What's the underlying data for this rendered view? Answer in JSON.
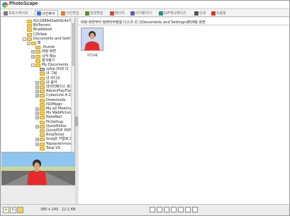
{
  "window": {
    "title": "PhotoScape"
  },
  "tabs": [
    {
      "label": "포토스케이프",
      "icon": "home-icon",
      "color": "#7a7a7a"
    },
    {
      "label": "사진뷰어",
      "icon": "viewer-icon",
      "color": "#3c78d8"
    },
    {
      "label": "사진편집",
      "icon": "editor-icon",
      "color": "#e07b39"
    },
    {
      "label": "일괄편집",
      "icon": "batch-icon",
      "color": "#5a8f29"
    },
    {
      "label": "페이지",
      "icon": "page-icon",
      "color": "#d04a4a"
    },
    {
      "label": "이어붙이기",
      "icon": "combine-icon",
      "color": "#6b5aa8"
    },
    {
      "label": "GIF애니메이션",
      "icon": "gif-icon",
      "color": "#2e8b8b"
    },
    {
      "label": "인쇄",
      "icon": "print-icon",
      "color": "#555555"
    },
    {
      "label": "도움말",
      "icon": "help-icon",
      "color": "#d33a2c"
    }
  ],
  "folder_tree": [
    {
      "label": "42c188942ad09c4e759e",
      "depth": 0,
      "expander": "",
      "icon": "folder-icon"
    },
    {
      "label": "BitTorrent",
      "depth": 0,
      "expander": "",
      "icon": "folder-icon"
    },
    {
      "label": "BlueNote4",
      "depth": 0,
      "expander": "",
      "icon": "folder-icon"
    },
    {
      "label": "CDView",
      "depth": 0,
      "expander": "",
      "icon": "folder-icon"
    },
    {
      "label": "Documents and Settings",
      "depth": 0,
      "expander": "-",
      "icon": "folder-icon"
    },
    {
      "label": "뽀",
      "depth": 1,
      "expander": "-",
      "icon": "folder-icon"
    },
    {
      "label": ".thumb",
      "depth": 2,
      "expander": "",
      "icon": "folder-icon"
    },
    {
      "label": "바탕 화면",
      "depth": 2,
      "expander": "+",
      "icon": "folder-icon"
    },
    {
      "label": "시작 메뉴",
      "depth": 2,
      "expander": "+",
      "icon": "folder-icon"
    },
    {
      "label": "즐겨찾기",
      "depth": 2,
      "expander": "",
      "icon": "folder-icon"
    },
    {
      "label": "My Documents",
      "depth": 2,
      "expander": "-",
      "icon": "folder-icon"
    },
    {
      "label": "ssfsp DVD (C",
      "depth": 3,
      "expander": "",
      "icon": "disk-icon"
    },
    {
      "label": "내 그림",
      "depth": 3,
      "expander": "",
      "icon": "folder-icon"
    },
    {
      "label": "내 비디오",
      "depth": 3,
      "expander": "",
      "icon": "folder-icon"
    },
    {
      "label": "내 음악",
      "depth": 3,
      "expander": "+",
      "icon": "folder-icon"
    },
    {
      "label": "데이터베이스 분권",
      "depth": 3,
      "expander": "+",
      "icon": "folder-icon"
    },
    {
      "label": "AlbumPlayFlash",
      "depth": 3,
      "expander": "+",
      "icon": "folder-icon"
    },
    {
      "label": "CyberLink-4.2",
      "depth": 3,
      "expander": "+",
      "icon": "folder-icon"
    },
    {
      "label": "Downloads",
      "depth": 3,
      "expander": "",
      "icon": "folder-icon"
    },
    {
      "label": "ISOMagic",
      "depth": 3,
      "expander": "",
      "icon": "folder-icon"
    },
    {
      "label": "My eZ Meeting",
      "depth": 3,
      "expander": "+",
      "icon": "folder-icon"
    },
    {
      "label": "My WebPictures",
      "depth": 3,
      "expander": "+",
      "icon": "folder-icon"
    },
    {
      "label": "NateMail",
      "depth": 3,
      "expander": "+",
      "icon": "folder-icon"
    },
    {
      "label": "PicSelhup",
      "depth": 3,
      "expander": "",
      "icon": "folder-icon"
    },
    {
      "label": "QuickEditor",
      "depth": 3,
      "expander": "+",
      "icon": "folder-icon"
    },
    {
      "label": "QuickPDF PDF",
      "depth": 3,
      "expander": "",
      "icon": "folder-icon"
    },
    {
      "label": "RingTones",
      "depth": 3,
      "expander": "",
      "icon": "folder-icon"
    },
    {
      "label": "SnagIt 카탈로그",
      "depth": 3,
      "expander": "+",
      "icon": "folder-icon"
    },
    {
      "label": "Topsaveinmovie",
      "depth": 3,
      "expander": "+",
      "icon": "folder-icon"
    },
    {
      "label": "Total VS",
      "depth": 3,
      "expander": "",
      "icon": "folder-icon"
    }
  ],
  "path_bar": "바탕 화면부터 컴퓨터부분을 디스크 (C:)\\Documents and Settings\\뽀\\바탕 화면",
  "thumbnail": {
    "caption": "사진.jpg"
  },
  "status": {
    "dimensions": "380 x 245",
    "file_size": "12.1 KB"
  }
}
